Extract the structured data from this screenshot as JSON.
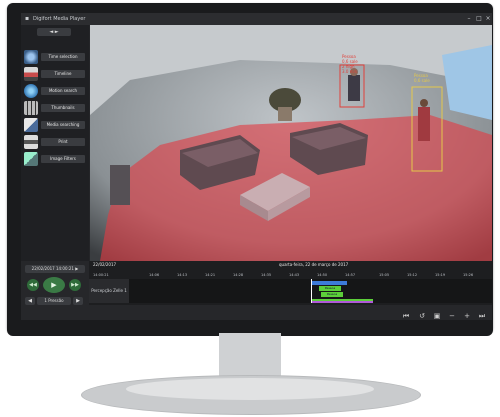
{
  "window": {
    "title": "Digifort Media Player"
  },
  "sidebar": {
    "top_button": "◄ ►",
    "items": [
      {
        "label": "Time selection",
        "icon": "clock-icon",
        "color": "#7aa6d8"
      },
      {
        "label": "Timeline",
        "icon": "timeline-icon",
        "color": "#c84b4b"
      },
      {
        "label": "Motion search",
        "icon": "globe-icon",
        "color": "#4aa3d8"
      },
      {
        "label": "Thumbnails",
        "icon": "thumbnails-icon",
        "color": "#c0c0c0"
      },
      {
        "label": "Media searching",
        "icon": "media-search-icon",
        "color": "#d8d8d8"
      },
      {
        "label": "Print",
        "icon": "printer-icon",
        "color": "#cfcfcf"
      },
      {
        "label": "Image Filters",
        "icon": "image-filter-icon",
        "color": "#8aa"
      }
    ]
  },
  "bottom": {
    "datetime": "22/02/2017 14:00:21 ▶",
    "playback_label": "1 Pressão",
    "timeline_date": "22/02/2017",
    "timeline_header": "quarta-feira, 22 de março de 2017",
    "tick_labels": [
      "14:00:21",
      "14:06",
      "14:13",
      "14:21",
      "14:28",
      "14:35",
      "14:43",
      "14:50",
      "14:57",
      "15:05",
      "15:12",
      "15:19",
      "15:26"
    ],
    "track_label": "Percepção Zelle 1",
    "event_labels": [
      "Pessoa",
      "Pessoa"
    ]
  },
  "detections": [
    {
      "label_lines": [
        "Pessoa",
        "0,6 sale",
        "2 high",
        "3.0 m/s"
      ],
      "color": "#e0403a"
    },
    {
      "label_lines": [
        "Pessoa",
        "0,6 sale"
      ],
      "color": "#e5c84a"
    }
  ],
  "colors": {
    "overlay": "#e13b43",
    "accent_green": "#5ccf3a",
    "accent_blue": "#3d7bd8"
  }
}
